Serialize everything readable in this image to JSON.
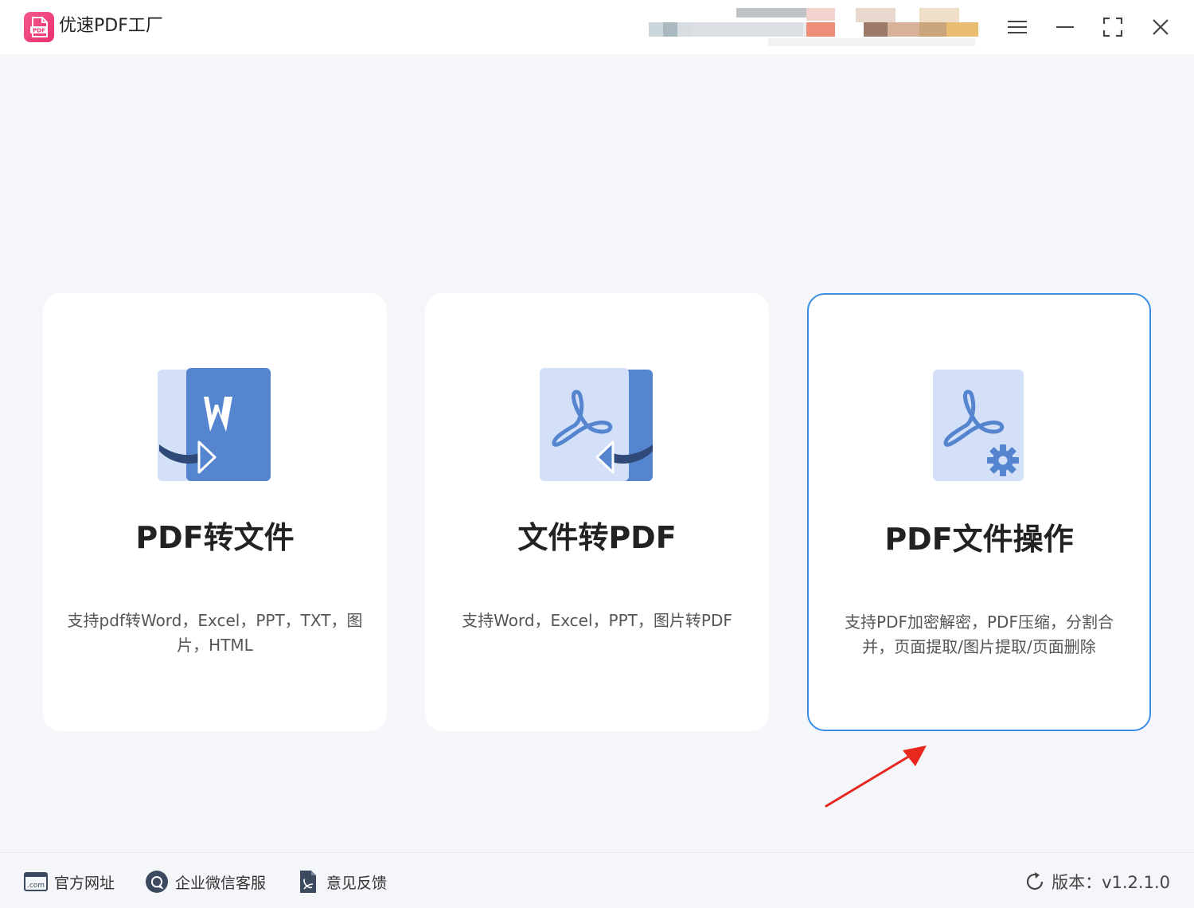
{
  "app": {
    "title": "优速PDF工厂",
    "logo_text": "PDF",
    "brand_color": "#e8316b"
  },
  "window_controls": {
    "menu_icon": "hamburger-menu-icon",
    "minimize_icon": "minimize-icon",
    "maximize_icon": "fullscreen-icon",
    "close_icon": "close-icon"
  },
  "cards": [
    {
      "title": "PDF转文件",
      "description": "支持pdf转Word，Excel，PPT，TXT，图片，HTML",
      "icon": "pdf-to-word-icon",
      "selected": false
    },
    {
      "title": "文件转PDF",
      "description": "支持Word，Excel，PPT，图片转PDF",
      "icon": "file-to-pdf-icon",
      "selected": false
    },
    {
      "title": "PDF文件操作",
      "description": "支持PDF加密解密，PDF压缩，分割合并，页面提取/图片提取/页面删除",
      "icon": "pdf-operation-icon",
      "selected": true
    }
  ],
  "footer": {
    "website": {
      "label": "官方网址",
      "icon": "website-icon",
      "icon_text": ".com"
    },
    "support": {
      "label": "企业微信客服",
      "icon": "chat-icon"
    },
    "feedback": {
      "label": "意见反馈",
      "icon": "feedback-icon"
    },
    "version": {
      "label": "版本：v1.2.1.0",
      "icon": "refresh-icon"
    }
  },
  "colors": {
    "accent": "#3a8ee6",
    "icon_dark": "#5585cf",
    "icon_light": "#d3e0f7",
    "annotation": "#e8271f"
  }
}
